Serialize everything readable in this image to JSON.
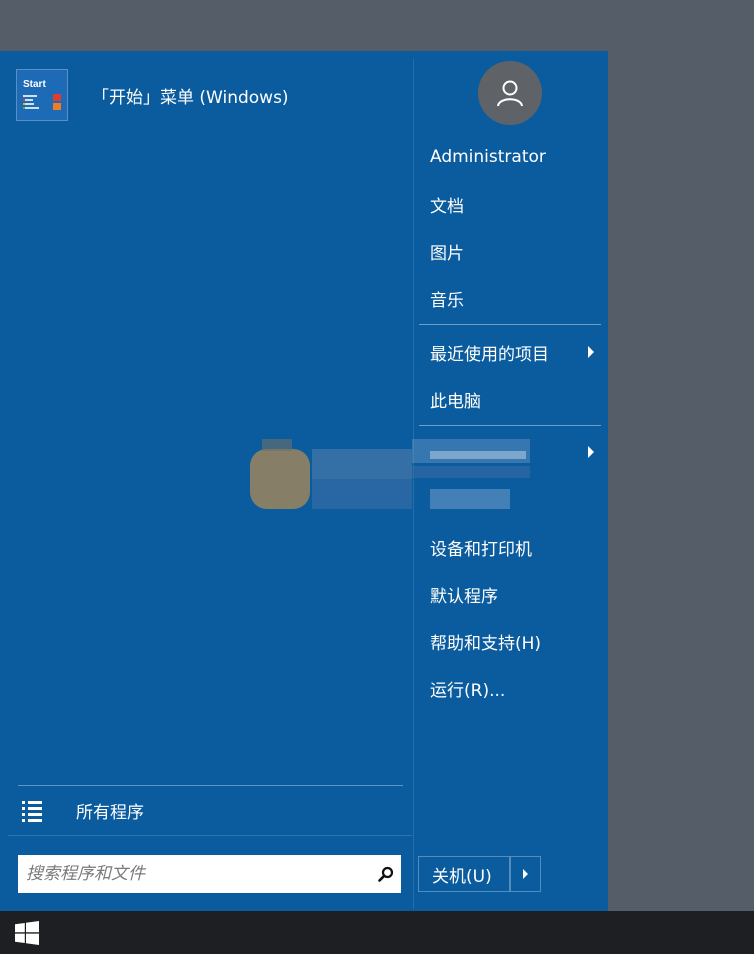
{
  "start_menu": {
    "pinned": [
      {
        "label": "「开始」菜单 (Windows)",
        "tile_title": "Start",
        "icon": "start-menu-app-icon"
      }
    ],
    "all_programs": {
      "label": "所有程序",
      "icon": "list-icon"
    },
    "search": {
      "placeholder": "搜索程序和文件",
      "value": "",
      "icon": "search-icon"
    }
  },
  "right_pane": {
    "avatar_icon": "user-icon",
    "user_name": "Administrator",
    "items": [
      {
        "label": "文档",
        "has_submenu": false
      },
      {
        "label": "图片",
        "has_submenu": false
      },
      {
        "label": "音乐",
        "has_submenu": false
      },
      {
        "label": "最近使用的项目",
        "has_submenu": true
      },
      {
        "label": "此电脑",
        "has_submenu": false
      },
      {
        "label": "设备和打印机",
        "has_submenu": false
      },
      {
        "label": "默认程序",
        "has_submenu": false
      },
      {
        "label": "帮助和支持(H)",
        "has_submenu": false
      },
      {
        "label": "运行(R)...",
        "has_submenu": false
      }
    ],
    "shutdown": {
      "label": "关机(U)",
      "arrow_icon": "chevron-right-icon"
    }
  },
  "taskbar": {
    "start_icon": "windows-logo-icon"
  },
  "colors": {
    "menu_bg": "#0a5c9e",
    "desktop_bg": "#545d68",
    "taskbar_bg": "#1e1f22",
    "avatar_bg": "#5f6368"
  }
}
